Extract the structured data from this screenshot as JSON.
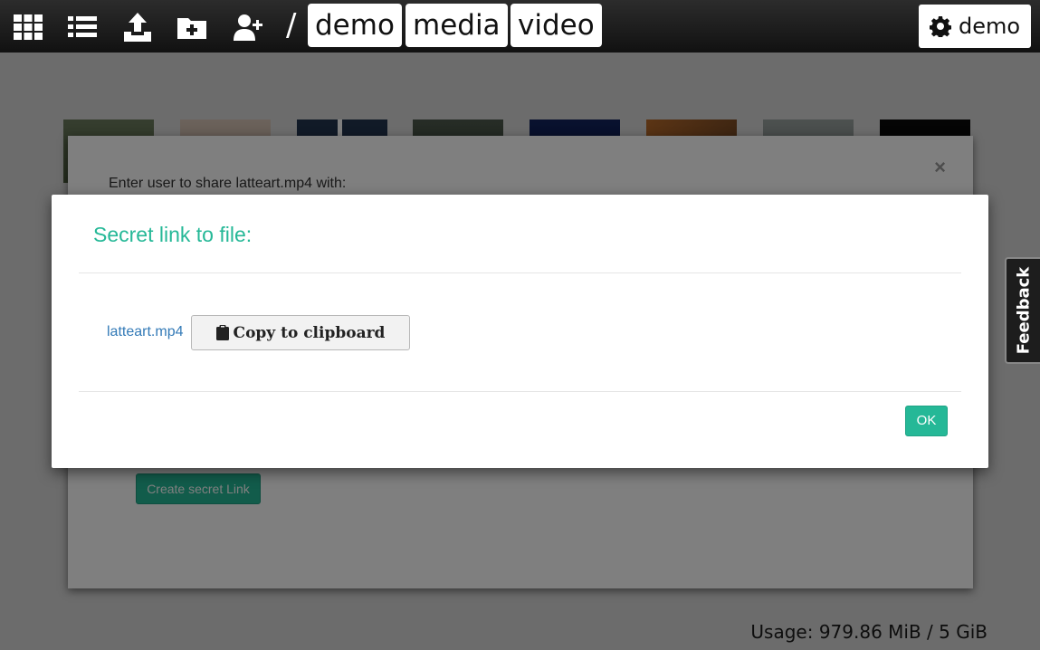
{
  "toolbar": {
    "icons": [
      "grid-view-icon",
      "list-view-icon",
      "upload-icon",
      "new-folder-icon",
      "add-user-icon"
    ],
    "separator": "/",
    "breadcrumbs": [
      "demo",
      "media",
      "video"
    ],
    "user_label": "demo",
    "user_icon": "gear-icon"
  },
  "gallery": {
    "thumbnail_count": 8
  },
  "usage": "Usage: 979.86 MiB / 5 GiB",
  "share_dialog": {
    "prompt": "Enter user to share latteart.mp4 with:",
    "close_glyph": "×",
    "create_link_label": "Create secret Link"
  },
  "secret_dialog": {
    "title": "Secret link to file:",
    "file_link": "latteart.mp4",
    "copy_label": "Copy to clipboard",
    "copy_icon": "clipboard-icon",
    "ok_label": "OK"
  },
  "feedback_tab": "Feedback",
  "colors": {
    "accent": "#25b897",
    "link": "#337ab7",
    "toolbar_bg": "#111111"
  }
}
